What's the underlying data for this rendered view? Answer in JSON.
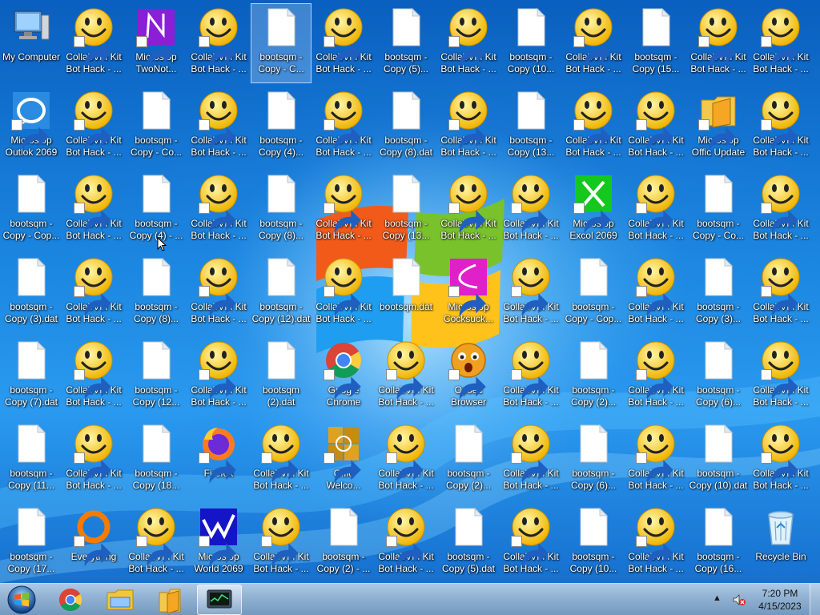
{
  "desktop": {
    "icons": [
      {
        "label": "My Computer",
        "icon": "computer-icon",
        "shortcut": false
      },
      {
        "label": "Microslop\nOutlok 2069",
        "icon": "outlook-icon",
        "shortcut": true
      },
      {
        "label": "bootsqm -\nCopy - Cop...",
        "icon": "file-icon",
        "shortcut": false
      },
      {
        "label": "bootsqm -\nCopy (3).dat",
        "icon": "file-icon",
        "shortcut": false
      },
      {
        "label": "bootsqm -\nCopy (7).dat",
        "icon": "file-icon",
        "shortcut": false
      },
      {
        "label": "bootsqm -\nCopy (11...",
        "icon": "file-icon",
        "shortcut": false
      },
      {
        "label": "bootsqm -\nCopy (17...",
        "icon": "file-icon",
        "shortcut": false
      },
      {
        "label": "CollabVM Kit\nBot Hack - ...",
        "icon": "smiley-icon",
        "shortcut": true
      },
      {
        "label": "CollabVM Kit\nBot Hack - ...",
        "icon": "smiley-icon",
        "shortcut": true
      },
      {
        "label": "CollabVM Kit\nBot Hack - ...",
        "icon": "smiley-icon",
        "shortcut": true
      },
      {
        "label": "CollabVM Kit\nBot Hack - ...",
        "icon": "smiley-icon",
        "shortcut": true
      },
      {
        "label": "CollabVM Kit\nBot Hack - ...",
        "icon": "smiley-icon",
        "shortcut": true
      },
      {
        "label": "CollabVM Kit\nBot Hack - ...",
        "icon": "smiley-icon",
        "shortcut": true
      },
      {
        "label": "Everything",
        "icon": "everything-icon",
        "shortcut": true
      },
      {
        "label": "Microslop\nTwoNot...",
        "icon": "onenote-icon",
        "shortcut": true
      },
      {
        "label": "bootsqm -\nCopy - Co...",
        "icon": "file-icon",
        "shortcut": false
      },
      {
        "label": "bootsqm -\nCopy (4) - ...",
        "icon": "file-icon",
        "shortcut": false
      },
      {
        "label": "bootsqm -\nCopy (8)...",
        "icon": "file-icon",
        "shortcut": false
      },
      {
        "label": "bootsqm -\nCopy (12...",
        "icon": "file-icon",
        "shortcut": false
      },
      {
        "label": "bootsqm -\nCopy (18...",
        "icon": "file-icon",
        "shortcut": false
      },
      {
        "label": "CollabVM Kit\nBot Hack - ...",
        "icon": "smiley-icon",
        "shortcut": true
      },
      {
        "label": "CollabVM Kit\nBot Hack - ...",
        "icon": "smiley-icon",
        "shortcut": true
      },
      {
        "label": "CollabVM Kit\nBot Hack - ...",
        "icon": "smiley-icon",
        "shortcut": true
      },
      {
        "label": "CollabVM Kit\nBot Hack - ...",
        "icon": "smiley-icon",
        "shortcut": true
      },
      {
        "label": "CollabVM Kit\nBot Hack - ...",
        "icon": "smiley-icon",
        "shortcut": true
      },
      {
        "label": "CollabVM Kit\nBot Hack - ...",
        "icon": "smiley-icon",
        "shortcut": true
      },
      {
        "label": "Firefox",
        "icon": "firefox-icon",
        "shortcut": true
      },
      {
        "label": "Microslop\nWorld 2069",
        "icon": "word-icon",
        "shortcut": true
      },
      {
        "label": "bootsqm -\nCopy - C...",
        "icon": "file-icon",
        "shortcut": false,
        "selected": true
      },
      {
        "label": "bootsqm -\nCopy (4)...",
        "icon": "file-icon",
        "shortcut": false
      },
      {
        "label": "bootsqm -\nCopy (8)...",
        "icon": "file-icon",
        "shortcut": false
      },
      {
        "label": "bootsqm -\nCopy (12).dat",
        "icon": "file-icon",
        "shortcut": false
      },
      {
        "label": "bootsqm\n(2).dat",
        "icon": "file-icon",
        "shortcut": false
      },
      {
        "label": "CollabVM Kit\nBot Hack - ...",
        "icon": "smiley-icon",
        "shortcut": true
      },
      {
        "label": "CollabVM Kit\nBot Hack - ...",
        "icon": "smiley-icon",
        "shortcut": true
      },
      {
        "label": "CollabVM Kit\nBot Hack - ...",
        "icon": "smiley-icon",
        "shortcut": true
      },
      {
        "label": "CollabVM Kit\nBot Hack - ...",
        "icon": "smiley-icon",
        "shortcut": true
      },
      {
        "label": "CollabVM Kit\nBot Hack - ...",
        "icon": "smiley-icon",
        "shortcut": true
      },
      {
        "label": "CollabVM Kit\nBot Hack - ...",
        "icon": "smiley-icon",
        "shortcut": true
      },
      {
        "label": "Google\nChrome",
        "icon": "chrome-icon",
        "shortcut": true
      },
      {
        "label": "Offic\nWelco...",
        "icon": "office-icon",
        "shortcut": true
      },
      {
        "label": "bootsqm -\nCopy (2) - ...",
        "icon": "file-icon",
        "shortcut": false
      },
      {
        "label": "bootsqm -\nCopy (5)...",
        "icon": "file-icon",
        "shortcut": false
      },
      {
        "label": "bootsqm -\nCopy (8).dat",
        "icon": "file-icon",
        "shortcut": false
      },
      {
        "label": "bootsqm -\nCopy (13...",
        "icon": "file-icon",
        "shortcut": false
      },
      {
        "label": "bootsqm.dat",
        "icon": "file-icon",
        "shortcut": false
      },
      {
        "label": "CollabVM Kit\nBot Hack - ...",
        "icon": "smiley-icon",
        "shortcut": true
      },
      {
        "label": "CollabVM Kit\nBot Hack - ...",
        "icon": "smiley-icon",
        "shortcut": true
      },
      {
        "label": "CollabVM Kit\nBot Hack - ...",
        "icon": "smiley-icon",
        "shortcut": true
      },
      {
        "label": "CollabVM Kit\nBot Hack - ...",
        "icon": "smiley-icon",
        "shortcut": true
      },
      {
        "label": "CollabVM Kit\nBot Hack - ...",
        "icon": "smiley-icon",
        "shortcut": true
      },
      {
        "label": "CollabVM Kit\nBot Hack - ...",
        "icon": "smiley-icon",
        "shortcut": true
      },
      {
        "label": "Microslop\nCocksuck...",
        "icon": "pink-app-icon",
        "shortcut": true
      },
      {
        "label": "Opsec\nBrowser",
        "icon": "opsec-icon",
        "shortcut": true
      },
      {
        "label": "bootsqm -\nCopy (2)...",
        "icon": "file-icon",
        "shortcut": false
      },
      {
        "label": "bootsqm -\nCopy (5).dat",
        "icon": "file-icon",
        "shortcut": false
      },
      {
        "label": "bootsqm -\nCopy (10...",
        "icon": "file-icon",
        "shortcut": false
      },
      {
        "label": "bootsqm -\nCopy (13...",
        "icon": "file-icon",
        "shortcut": false
      },
      {
        "label": "CollabVM Kit\nBot Hack - ...",
        "icon": "smiley-icon",
        "shortcut": true
      },
      {
        "label": "CollabVM Kit\nBot Hack - ...",
        "icon": "smiley-icon",
        "shortcut": true
      },
      {
        "label": "CollabVM Kit\nBot Hack - ...",
        "icon": "smiley-icon",
        "shortcut": true
      },
      {
        "label": "CollabVM Kit\nBot Hack - ...",
        "icon": "smiley-icon",
        "shortcut": true
      },
      {
        "label": "CollabVM Kit\nBot Hack - ...",
        "icon": "smiley-icon",
        "shortcut": true
      },
      {
        "label": "CollabVM Kit\nBot Hack - ...",
        "icon": "smiley-icon",
        "shortcut": true
      },
      {
        "label": "CollabVM Kit\nBot Hack - ...",
        "icon": "smiley-icon",
        "shortcut": true
      },
      {
        "label": "Microslop\nExcol 2069",
        "icon": "excel-icon",
        "shortcut": true
      },
      {
        "label": "bootsqm -\nCopy - Cop...",
        "icon": "file-icon",
        "shortcut": false
      },
      {
        "label": "bootsqm -\nCopy (2)...",
        "icon": "file-icon",
        "shortcut": false
      },
      {
        "label": "bootsqm -\nCopy (6)...",
        "icon": "file-icon",
        "shortcut": false
      },
      {
        "label": "bootsqm -\nCopy (10...",
        "icon": "file-icon",
        "shortcut": false
      },
      {
        "label": "bootsqm -\nCopy (15...",
        "icon": "file-icon",
        "shortcut": false
      },
      {
        "label": "CollabVM Kit\nBot Hack - ...",
        "icon": "smiley-icon",
        "shortcut": true
      },
      {
        "label": "CollabVM Kit\nBot Hack - ...",
        "icon": "smiley-icon",
        "shortcut": true
      },
      {
        "label": "CollabVM Kit\nBot Hack - ...",
        "icon": "smiley-icon",
        "shortcut": true
      },
      {
        "label": "CollabVM Kit\nBot Hack - ...",
        "icon": "smiley-icon",
        "shortcut": true
      },
      {
        "label": "CollabVM Kit\nBot Hack - ...",
        "icon": "smiley-icon",
        "shortcut": true
      },
      {
        "label": "CollabVM Kit\nBot Hack - ...",
        "icon": "smiley-icon",
        "shortcut": true
      },
      {
        "label": "CollabVM Kit\nBot Hack - ...",
        "icon": "smiley-icon",
        "shortcut": true
      },
      {
        "label": "Microslop\nOffic Update",
        "icon": "office-update-icon",
        "shortcut": true
      },
      {
        "label": "bootsqm -\nCopy - Co...",
        "icon": "file-icon",
        "shortcut": false
      },
      {
        "label": "bootsqm -\nCopy (3)...",
        "icon": "file-icon",
        "shortcut": false
      },
      {
        "label": "bootsqm -\nCopy (6)...",
        "icon": "file-icon",
        "shortcut": false
      },
      {
        "label": "bootsqm -\nCopy (10).dat",
        "icon": "file-icon",
        "shortcut": false
      },
      {
        "label": "bootsqm -\nCopy (16...",
        "icon": "file-icon",
        "shortcut": false
      },
      {
        "label": "CollabVM Kit\nBot Hack - ...",
        "icon": "smiley-icon",
        "shortcut": true
      },
      {
        "label": "CollabVM Kit\nBot Hack - ...",
        "icon": "smiley-icon",
        "shortcut": true
      },
      {
        "label": "CollabVM Kit\nBot Hack - ...",
        "icon": "smiley-icon",
        "shortcut": true
      },
      {
        "label": "CollabVM Kit\nBot Hack - ...",
        "icon": "smiley-icon",
        "shortcut": true
      },
      {
        "label": "CollabVM Kit\nBot Hack - ...",
        "icon": "smiley-icon",
        "shortcut": true
      },
      {
        "label": "CollabVM Kit\nBot Hack - ...",
        "icon": "smiley-icon",
        "shortcut": true
      },
      {
        "label": "Recycle Bin",
        "icon": "recycle-bin-icon",
        "shortcut": false
      }
    ]
  },
  "taskbar": {
    "start_icon": "windows-orb-icon",
    "apps": [
      {
        "name": "chrome-icon",
        "active": false
      },
      {
        "name": "file-explorer-icon",
        "active": false
      },
      {
        "name": "folder-app-icon",
        "active": false
      },
      {
        "name": "task-manager-icon",
        "active": true
      }
    ],
    "tray": {
      "arrow": "▲",
      "volume_icon": "volume-muted-icon",
      "time": "7:20 PM",
      "date": "4/15/2023"
    }
  },
  "colors": {
    "taskbar": "#a9c1dc",
    "smiley": "#ffd21f",
    "accent": "#1f7ad6"
  }
}
